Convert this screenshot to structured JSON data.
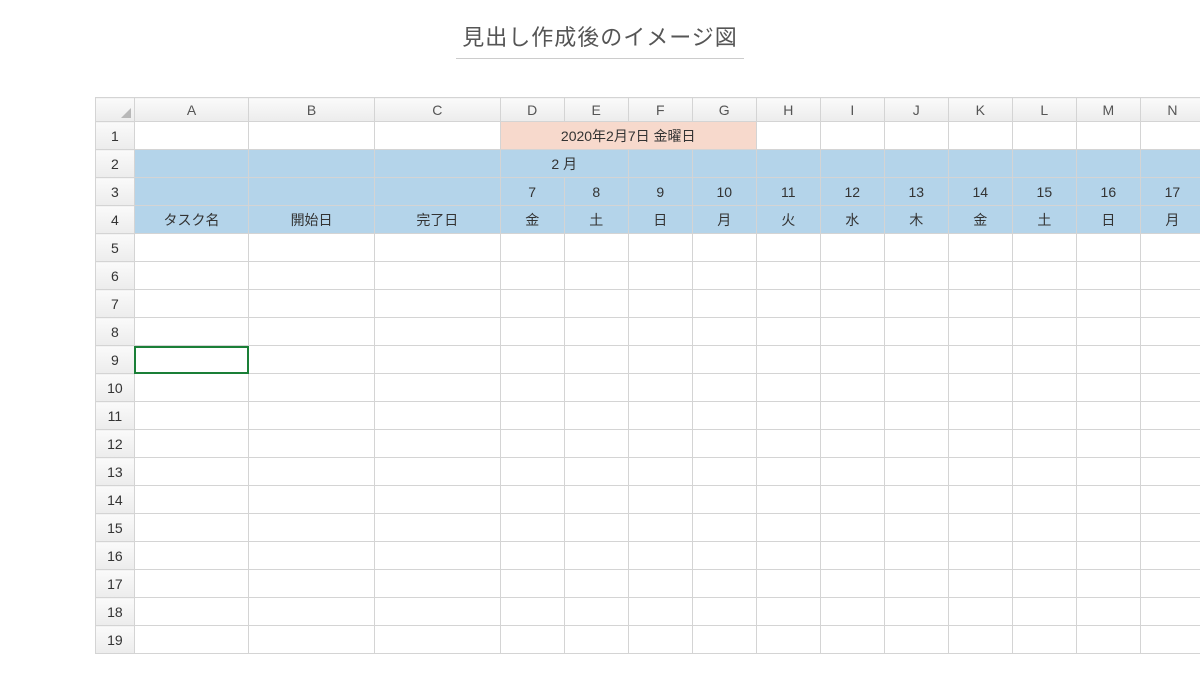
{
  "caption": "見出し作成後のイメージ図",
  "columns": [
    "A",
    "B",
    "C",
    "D",
    "E",
    "F",
    "G",
    "H",
    "I",
    "J",
    "K",
    "L",
    "M",
    "N"
  ],
  "rows": [
    1,
    2,
    3,
    4,
    5,
    6,
    7,
    8,
    9,
    10,
    11,
    12,
    13,
    14,
    15,
    16,
    17,
    18,
    19
  ],
  "row1": {
    "date_text": "2020年2月7日 金曜日"
  },
  "row2": {
    "month": "2 月"
  },
  "row3": {
    "days": [
      "7",
      "8",
      "9",
      "10",
      "11",
      "12",
      "13",
      "14",
      "15",
      "16",
      "17"
    ]
  },
  "row4": {
    "taskname": "タスク名",
    "start": "開始日",
    "end": "完了日",
    "weekdays": [
      "金",
      "土",
      "日",
      "月",
      "火",
      "水",
      "木",
      "金",
      "土",
      "日",
      "月"
    ]
  }
}
